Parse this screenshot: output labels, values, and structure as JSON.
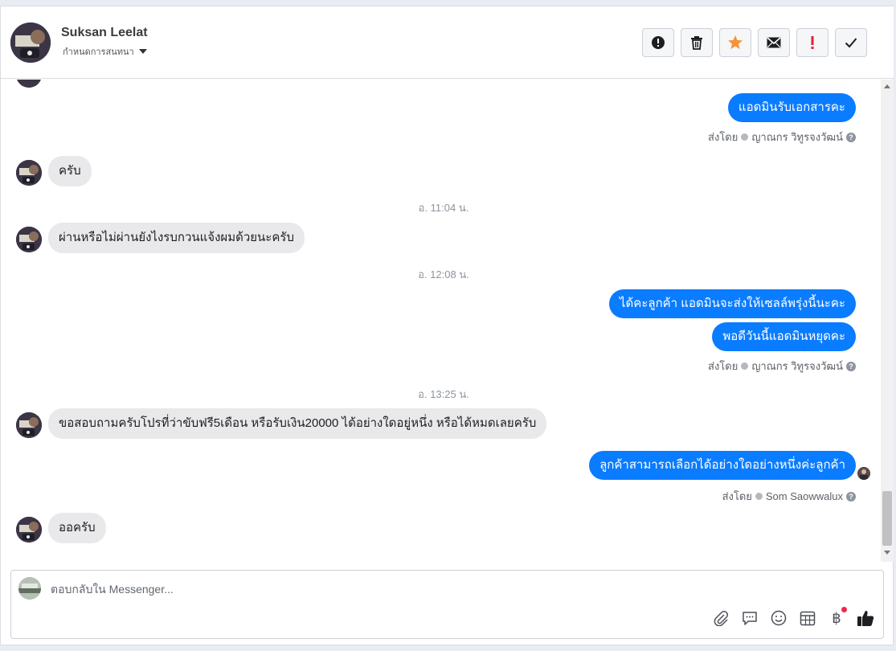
{
  "header": {
    "contact_name": "Suksan Leelat",
    "assign_label": "กำหนดการสนทนา",
    "actions": [
      {
        "name": "spam-report",
        "icon": "alert-circle-icon"
      },
      {
        "name": "delete",
        "icon": "trash-icon"
      },
      {
        "name": "star",
        "icon": "star-icon"
      },
      {
        "name": "mark-unread",
        "icon": "envelope-icon"
      },
      {
        "name": "flag-important",
        "icon": "exclamation-icon"
      },
      {
        "name": "mark-done",
        "icon": "checkmark-icon"
      }
    ]
  },
  "messages": {
    "m1": "แอดมินรับเอกสารคะ",
    "m1_sent_prefix": "ส่งโดย",
    "m1_sender": "ญาณกร วิทูรจงวัฒน์",
    "m2": "ครับ",
    "t1": "อ. 11:04 น.",
    "m3": "ผ่านหรือไม่ผ่านยังไงรบกวนแจ้งผมด้วยนะครับ",
    "t2": "อ. 12:08 น.",
    "m4": "ได้คะลูกค้า แอดมินจะส่งให้เซลล์พรุ่งนี้นะคะ",
    "m5": "พอดีวันนี้แอดมินหยุดคะ",
    "m5_sent_prefix": "ส่งโดย",
    "m5_sender": "ญาณกร วิทูรจงวัฒน์",
    "t3": "อ. 13:25 น.",
    "m6": "ขอสอบถามครับโปรที่ว่าขับฟรี5เดือน หรือรับเงิน20000 ได้อย่างใดอยู่หนึ่ง หรือได้หมดเลยครับ",
    "m7": "ลูกค้าสามารถเลือกได้อย่างใดอย่างหนึ่งค่ะลูกค้า",
    "m7_sent_prefix": "ส่งโดย",
    "m7_sender": "Som Saowwalux",
    "m8": "ออครับ"
  },
  "composer": {
    "placeholder": "ตอบกลับใน Messenger...",
    "tools": [
      "paperclip-icon",
      "saved-reply-icon",
      "emoji-icon",
      "appointment-icon",
      "payment-baht-icon",
      "thumbs-up-icon"
    ],
    "baht_symbol": "฿"
  },
  "colors": {
    "outgoing_bubble": "#0a7cff",
    "incoming_bubble": "#e9e9eb",
    "star": "#f7923b",
    "important": "#e41e3f"
  }
}
